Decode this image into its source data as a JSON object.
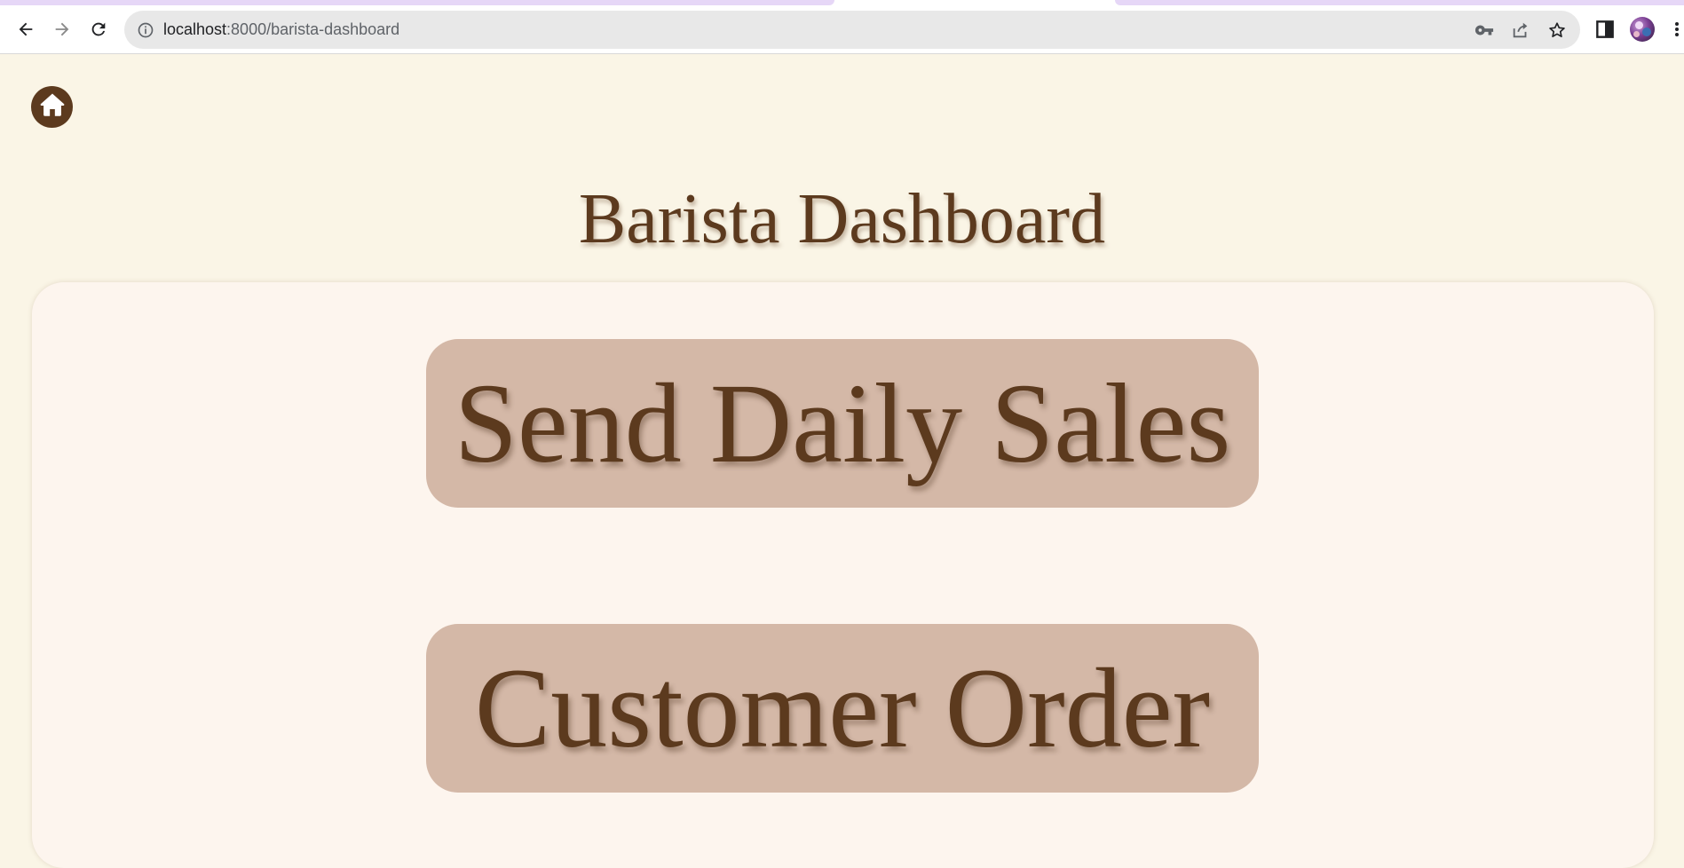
{
  "browser": {
    "url_host": "localhost",
    "url_path": ":8000/barista-dashboard",
    "icons": {
      "back": "back-arrow-icon",
      "forward": "forward-arrow-icon",
      "reload": "reload-icon",
      "site_info": "info-icon",
      "password": "key-icon",
      "share": "share-icon",
      "bookmark": "star-icon",
      "sidepanel": "side-panel-icon",
      "profile": "avatar",
      "menu": "more-vert-icon"
    }
  },
  "page": {
    "title": "Barista Dashboard",
    "home_icon": "home-icon",
    "buttons": {
      "send_daily_sales": "Send Daily Sales",
      "customer_order": "Customer Order"
    }
  },
  "colors": {
    "page_background": "#faf5e6",
    "card_background": "#fdf5ee",
    "button_background": "#d4b8a7",
    "brand_brown": "#5c3a1e",
    "tab_accent": "#e6d7f7"
  }
}
